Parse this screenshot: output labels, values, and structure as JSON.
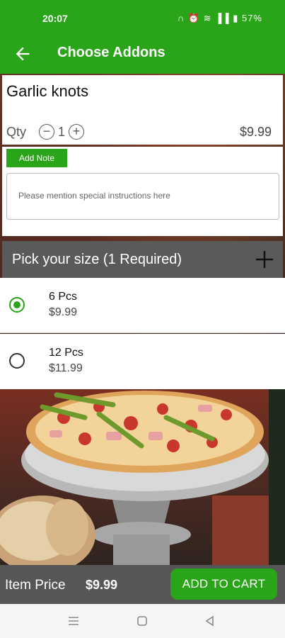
{
  "status_bar": {
    "time": "20:07",
    "battery": "57%"
  },
  "app_bar": {
    "title": "Choose Addons"
  },
  "item": {
    "name": "Garlic knots",
    "qty_label": "Qty",
    "qty_value": "1",
    "price": "$9.99"
  },
  "note": {
    "add_note_label": "Add Note",
    "placeholder": "Please mention special instructions here"
  },
  "size_section": {
    "title": "Pick your size (1 Required)",
    "options": [
      {
        "name": "6 Pcs",
        "price": "$9.99",
        "selected": true
      },
      {
        "name": "12 Pcs",
        "price": "$11.99",
        "selected": false
      }
    ]
  },
  "footer": {
    "price_label": "Item Price",
    "price_value": "$9.99",
    "add_to_cart": "ADD TO CART"
  },
  "colors": {
    "accent": "#2aa51a",
    "header_gray": "#5a5a5a",
    "footer_gray": "#565656"
  },
  "icons": [
    "back-arrow-icon",
    "minus-circle-icon",
    "plus-circle-icon",
    "plus-icon",
    "menu-nav-icon",
    "home-nav-icon",
    "back-nav-icon"
  ]
}
